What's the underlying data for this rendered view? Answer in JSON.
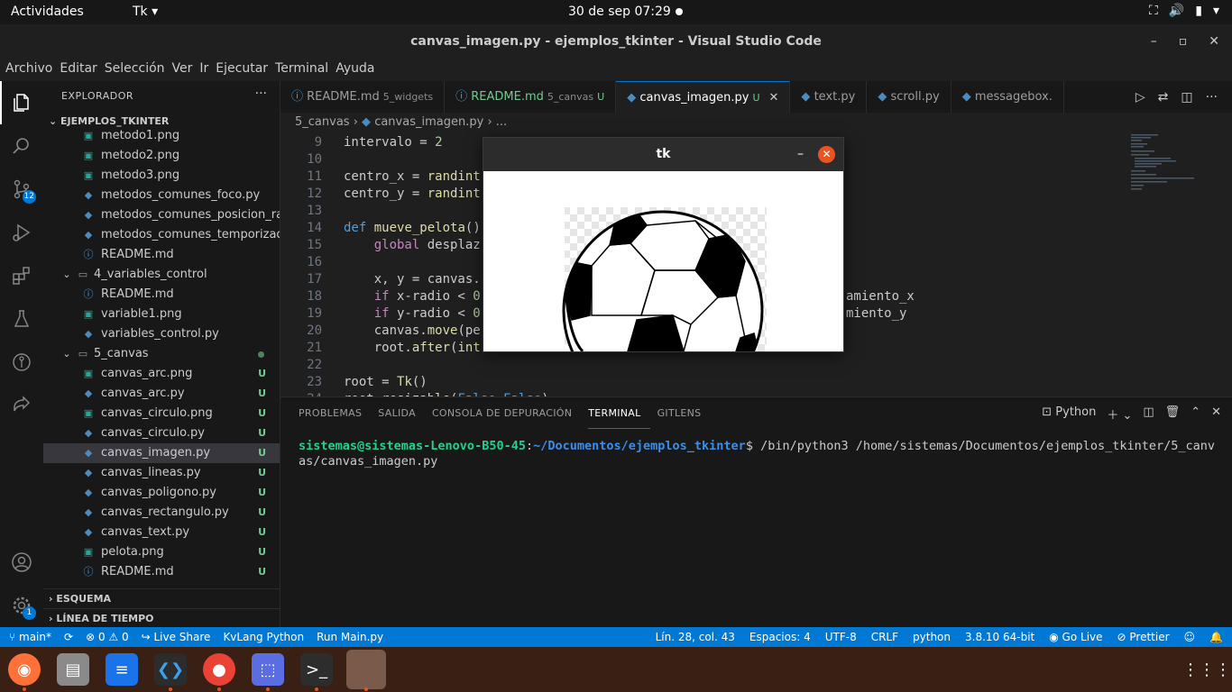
{
  "topbar": {
    "activities": "Actividades",
    "app_menu": "Tk ▾",
    "clock": "30 de sep  07:29"
  },
  "window": {
    "title": "canvas_imagen.py - ejemplos_tkinter - Visual Studio Code",
    "min": "–",
    "max": "▫",
    "close": "✕"
  },
  "menu": [
    "Archivo",
    "Editar",
    "Selección",
    "Ver",
    "Ir",
    "Ejecutar",
    "Terminal",
    "Ayuda"
  ],
  "activity": {
    "scm_badge": "12",
    "settings_badge": "1"
  },
  "sidebar": {
    "title": "EXPLORADOR",
    "more": "···",
    "root": "EJEMPLOS_TKINTER",
    "items": [
      {
        "label": "metodo1.png",
        "type": "png",
        "indent": 2
      },
      {
        "label": "metodo2.png",
        "type": "png",
        "indent": 2
      },
      {
        "label": "metodo3.png",
        "type": "png",
        "indent": 2
      },
      {
        "label": "metodos_comunes_foco.py",
        "type": "py",
        "indent": 2
      },
      {
        "label": "metodos_comunes_posicion_ra...",
        "type": "py",
        "indent": 2
      },
      {
        "label": "metodos_comunes_temporizad...",
        "type": "py",
        "indent": 2
      },
      {
        "label": "README.md",
        "type": "md",
        "indent": 2
      },
      {
        "label": "4_variables_control",
        "type": "folder",
        "indent": 1
      },
      {
        "label": "README.md",
        "type": "md",
        "indent": 2
      },
      {
        "label": "variable1.png",
        "type": "png",
        "indent": 2
      },
      {
        "label": "variables_control.py",
        "type": "py",
        "indent": 2
      },
      {
        "label": "5_canvas",
        "type": "folder",
        "indent": 1,
        "dot": true
      },
      {
        "label": "canvas_arc.png",
        "type": "png",
        "indent": 2,
        "git": "U"
      },
      {
        "label": "canvas_arc.py",
        "type": "py",
        "indent": 2,
        "git": "U"
      },
      {
        "label": "canvas_circulo.png",
        "type": "png",
        "indent": 2,
        "git": "U"
      },
      {
        "label": "canvas_circulo.py",
        "type": "py",
        "indent": 2,
        "git": "U"
      },
      {
        "label": "canvas_imagen.py",
        "type": "py",
        "indent": 2,
        "git": "U",
        "selected": true
      },
      {
        "label": "canvas_lineas.py",
        "type": "py",
        "indent": 2,
        "git": "U"
      },
      {
        "label": "canvas_poligono.py",
        "type": "py",
        "indent": 2,
        "git": "U"
      },
      {
        "label": "canvas_rectangulo.py",
        "type": "py",
        "indent": 2,
        "git": "U"
      },
      {
        "label": "canvas_text.py",
        "type": "py",
        "indent": 2,
        "git": "U"
      },
      {
        "label": "pelota.png",
        "type": "png",
        "indent": 2,
        "git": "U"
      },
      {
        "label": "README.md",
        "type": "md",
        "indent": 2,
        "git": "U"
      }
    ],
    "outline": "ESQUEMA",
    "timeline": "LÍNEA DE TIEMPO"
  },
  "tabs": [
    {
      "label": "README.md",
      "desc": "5_widgets",
      "icon": "info"
    },
    {
      "label": "README.md",
      "desc": "5_canvas",
      "status": "U",
      "icon": "info"
    },
    {
      "label": "canvas_imagen.py",
      "status": "U",
      "icon": "py",
      "active": true
    },
    {
      "label": "text.py",
      "icon": "py"
    },
    {
      "label": "scroll.py",
      "icon": "py"
    },
    {
      "label": "messagebox.",
      "icon": "py"
    }
  ],
  "breadcrumb": [
    "5_canvas",
    "canvas_imagen.py",
    "..."
  ],
  "code": [
    {
      "n": "9",
      "text": "intervalo = 2"
    },
    {
      "n": "10",
      "text": ""
    },
    {
      "n": "11",
      "text": "centro_x = randint"
    },
    {
      "n": "12",
      "text": "centro_y = randint"
    },
    {
      "n": "13",
      "text": ""
    },
    {
      "n": "14",
      "text": "def mueve_pelota()"
    },
    {
      "n": "15",
      "text": "    global desplaz"
    },
    {
      "n": "16",
      "text": ""
    },
    {
      "n": "17",
      "text": "    x, y = canvas."
    },
    {
      "n": "18",
      "text": "    if x-radio < 0",
      "tail": "amiento_x"
    },
    {
      "n": "19",
      "text": "    if y-radio < 0",
      "tail": "miento_y"
    },
    {
      "n": "20",
      "text": "    canvas.move(pe"
    },
    {
      "n": "21",
      "text": "    root.after(int"
    },
    {
      "n": "22",
      "text": ""
    },
    {
      "n": "23",
      "text": "root = Tk()"
    },
    {
      "n": "24",
      "text": "root.resizable(False,False)"
    }
  ],
  "tk": {
    "title": "tk",
    "min": "–",
    "close": "✕"
  },
  "panel": {
    "tabs": [
      "PROBLEMAS",
      "SALIDA",
      "CONSOLA DE DEPURACIÓN",
      "TERMINAL",
      "GITLENS"
    ],
    "active_tab": "TERMINAL",
    "shell": "Python",
    "prompt_user": "sistemas@sistemas-Lenovo-B50-45",
    "prompt_sep": ":",
    "prompt_path": "~/Documentos/ejemplos_tkinter",
    "command": "$ /bin/python3 /home/sistemas/Documentos/ejemplos_tkinter/5_canvas/canvas_imagen.py"
  },
  "status": {
    "branch": "main*",
    "errors": "0",
    "warnings": "0",
    "live_share": "Live Share",
    "kvlang": "KvLang Python",
    "run_main": "Run Main.py",
    "position": "Lín. 28, col. 43",
    "spaces": "Espacios: 4",
    "encoding": "UTF-8",
    "eol": "CRLF",
    "language": "python",
    "interpreter": "3.8.10 64-bit",
    "go_live": "Go Live",
    "prettier": "Prettier"
  },
  "colors": {
    "accent": "#0078d4",
    "git_untracked": "#73c991",
    "ubuntu_orange": "#e95420"
  }
}
